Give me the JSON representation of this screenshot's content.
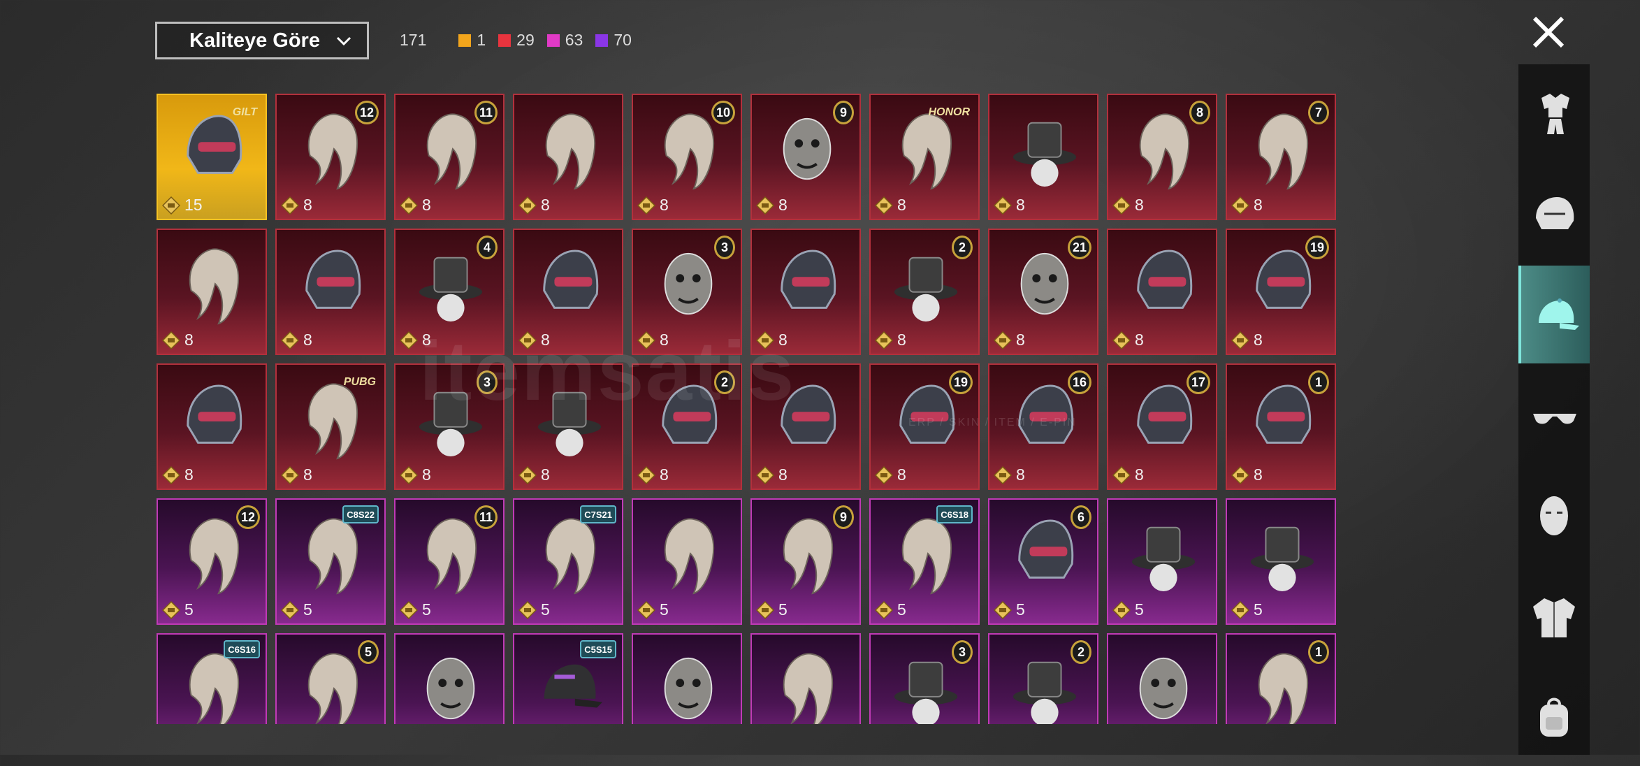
{
  "sort": {
    "label": "Kaliteye Göre"
  },
  "counts": {
    "total": "171",
    "gold": "1",
    "red": "29",
    "pink": "63",
    "purple": "70"
  },
  "colors": {
    "gold": "#f2a51c",
    "red": "#e8343e",
    "pink": "#e13ac6",
    "purple": "#8a36e6"
  },
  "watermark": {
    "text": "itemsatis",
    "sub": "ERP / SKIN / ITEM / E-PIN"
  },
  "items": [
    {
      "cost": "15",
      "badge": "GILT",
      "type": "logo",
      "tone": "gold",
      "icon": "helmet-icon"
    },
    {
      "cost": "8",
      "badge": "12",
      "type": "num",
      "tone": "red",
      "icon": "hair-icon"
    },
    {
      "cost": "8",
      "badge": "11",
      "type": "num",
      "tone": "red",
      "icon": "hair-icon"
    },
    {
      "cost": "8",
      "badge": "",
      "type": "",
      "tone": "red",
      "icon": "hair-icon"
    },
    {
      "cost": "8",
      "badge": "10",
      "type": "num",
      "tone": "red",
      "icon": "hair-icon"
    },
    {
      "cost": "8",
      "badge": "9",
      "type": "num",
      "tone": "red",
      "icon": "mask-icon"
    },
    {
      "cost": "8",
      "badge": "HONOR",
      "type": "logo",
      "tone": "red",
      "icon": "hair-icon"
    },
    {
      "cost": "8",
      "badge": "",
      "type": "",
      "tone": "red",
      "icon": "hat-icon"
    },
    {
      "cost": "8",
      "badge": "8",
      "type": "num",
      "tone": "red",
      "icon": "hair-icon"
    },
    {
      "cost": "8",
      "badge": "7",
      "type": "num",
      "tone": "red",
      "icon": "hair-icon"
    },
    {
      "cost": "8",
      "badge": "",
      "type": "",
      "tone": "red",
      "icon": "hair-icon"
    },
    {
      "cost": "8",
      "badge": "",
      "type": "",
      "tone": "red",
      "icon": "helmet-icon"
    },
    {
      "cost": "8",
      "badge": "4",
      "type": "num",
      "tone": "red",
      "icon": "hat-icon"
    },
    {
      "cost": "8",
      "badge": "",
      "type": "",
      "tone": "red",
      "icon": "helmet-icon"
    },
    {
      "cost": "8",
      "badge": "3",
      "type": "num",
      "tone": "red",
      "icon": "mask-icon"
    },
    {
      "cost": "8",
      "badge": "",
      "type": "",
      "tone": "red",
      "icon": "helmet-icon"
    },
    {
      "cost": "8",
      "badge": "2",
      "type": "num",
      "tone": "red",
      "icon": "hat-icon"
    },
    {
      "cost": "8",
      "badge": "21",
      "type": "num",
      "tone": "red",
      "icon": "mask-icon"
    },
    {
      "cost": "8",
      "badge": "",
      "type": "",
      "tone": "red",
      "icon": "helmet-icon"
    },
    {
      "cost": "8",
      "badge": "19",
      "type": "num",
      "tone": "red",
      "icon": "helmet-icon"
    },
    {
      "cost": "8",
      "badge": "",
      "type": "",
      "tone": "red",
      "icon": "helmet-icon"
    },
    {
      "cost": "8",
      "badge": "PUBG",
      "type": "logo",
      "tone": "red",
      "icon": "hair-icon"
    },
    {
      "cost": "8",
      "badge": "3",
      "type": "num",
      "tone": "red",
      "icon": "hat-icon"
    },
    {
      "cost": "8",
      "badge": "",
      "type": "",
      "tone": "red",
      "icon": "hat-icon"
    },
    {
      "cost": "8",
      "badge": "2",
      "type": "num",
      "tone": "red",
      "icon": "helmet-icon"
    },
    {
      "cost": "8",
      "badge": "",
      "type": "",
      "tone": "red",
      "icon": "helmet-icon"
    },
    {
      "cost": "8",
      "badge": "19",
      "type": "num",
      "tone": "red",
      "icon": "helmet-icon"
    },
    {
      "cost": "8",
      "badge": "16",
      "type": "num",
      "tone": "red",
      "icon": "helmet-icon"
    },
    {
      "cost": "8",
      "badge": "17",
      "type": "num",
      "tone": "red",
      "icon": "helmet-icon"
    },
    {
      "cost": "8",
      "badge": "1",
      "type": "num",
      "tone": "red",
      "icon": "helmet-icon"
    },
    {
      "cost": "5",
      "badge": "12",
      "type": "num",
      "tone": "purple",
      "icon": "hair-icon"
    },
    {
      "cost": "5",
      "badge": "C8S22",
      "type": "season",
      "tone": "purple",
      "icon": "hair-icon"
    },
    {
      "cost": "5",
      "badge": "11",
      "type": "num",
      "tone": "purple",
      "icon": "hair-icon"
    },
    {
      "cost": "5",
      "badge": "C7S21",
      "type": "season",
      "tone": "purple",
      "icon": "hair-icon"
    },
    {
      "cost": "5",
      "badge": "",
      "type": "",
      "tone": "purple",
      "icon": "hair-icon"
    },
    {
      "cost": "5",
      "badge": "9",
      "type": "num",
      "tone": "purple",
      "icon": "hair-icon"
    },
    {
      "cost": "5",
      "badge": "C6S18",
      "type": "season",
      "tone": "purple",
      "icon": "hair-icon"
    },
    {
      "cost": "5",
      "badge": "6",
      "type": "num",
      "tone": "purple",
      "icon": "helmet-icon"
    },
    {
      "cost": "5",
      "badge": "",
      "type": "",
      "tone": "purple",
      "icon": "hat-icon"
    },
    {
      "cost": "5",
      "badge": "",
      "type": "",
      "tone": "purple",
      "icon": "hat-icon"
    },
    {
      "cost": "",
      "badge": "C6S16",
      "type": "season",
      "tone": "purple",
      "icon": "hair-icon"
    },
    {
      "cost": "",
      "badge": "5",
      "type": "num",
      "tone": "purple",
      "icon": "hair-icon"
    },
    {
      "cost": "",
      "badge": "",
      "type": "",
      "tone": "purple",
      "icon": "mask-icon"
    },
    {
      "cost": "",
      "badge": "C5S15",
      "type": "season",
      "tone": "purple",
      "icon": "cap-icon"
    },
    {
      "cost": "",
      "badge": "",
      "type": "",
      "tone": "purple",
      "icon": "mask-icon"
    },
    {
      "cost": "",
      "badge": "",
      "type": "",
      "tone": "purple",
      "icon": "hair-icon"
    },
    {
      "cost": "",
      "badge": "3",
      "type": "num",
      "tone": "purple",
      "icon": "hat-icon"
    },
    {
      "cost": "",
      "badge": "2",
      "type": "num",
      "tone": "purple",
      "icon": "hat-icon"
    },
    {
      "cost": "",
      "badge": "",
      "type": "",
      "tone": "purple",
      "icon": "mask-icon"
    },
    {
      "cost": "",
      "badge": "1",
      "type": "num",
      "tone": "purple",
      "icon": "hair-icon"
    }
  ],
  "sidebar": [
    {
      "icon": "outfit-icon",
      "active": false
    },
    {
      "icon": "helmet-icon",
      "active": false
    },
    {
      "icon": "cap-icon",
      "active": true
    },
    {
      "icon": "sunglasses-icon",
      "active": false
    },
    {
      "icon": "face-icon",
      "active": false
    },
    {
      "icon": "jacket-icon",
      "active": false
    },
    {
      "icon": "backpack-icon",
      "active": false
    }
  ]
}
